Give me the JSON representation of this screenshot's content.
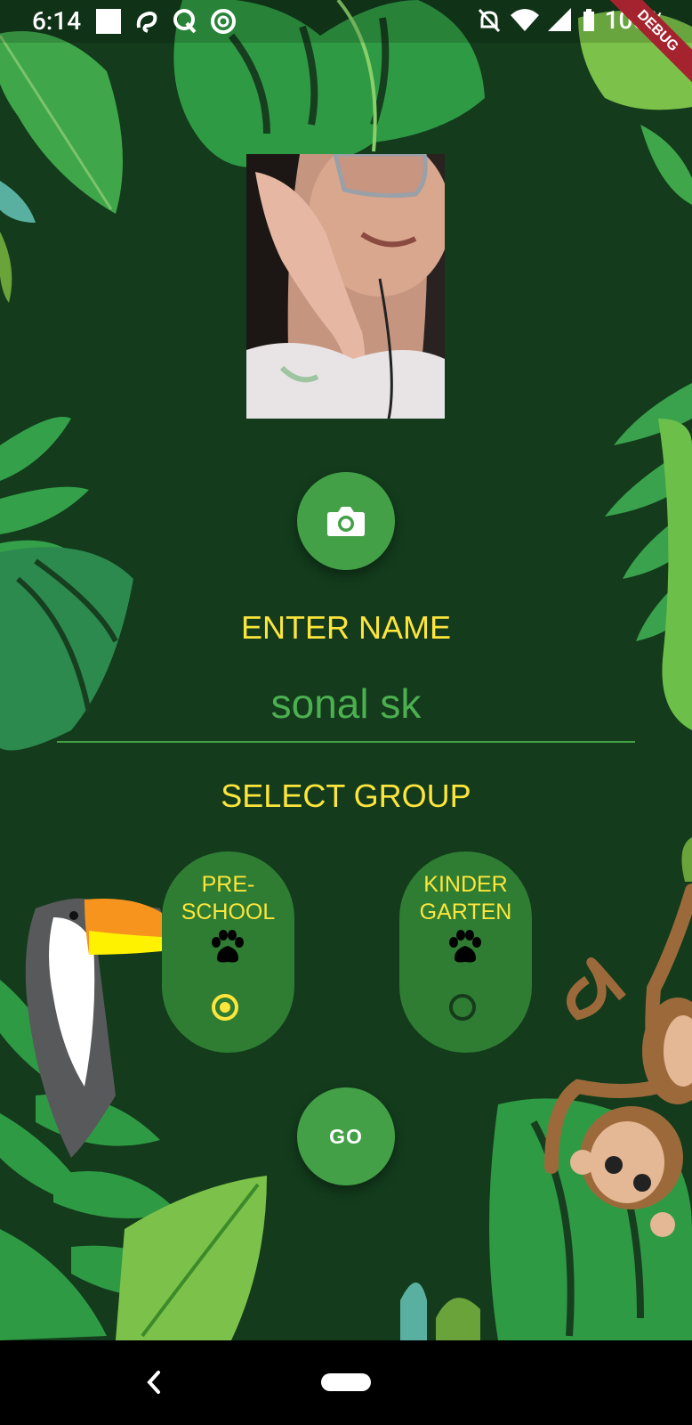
{
  "status_bar": {
    "time": "6:14",
    "battery_percent": "100%",
    "debug_banner": "DEBUG"
  },
  "profile": {
    "photo_alt": "profile-photo"
  },
  "name_section": {
    "heading": "ENTER NAME",
    "input_value": "sonal sk"
  },
  "group_section": {
    "heading": "SELECT GROUP",
    "options": [
      {
        "label": "PRE-\nSCHOOL",
        "selected": true
      },
      {
        "label": "KINDER\nGARTEN",
        "selected": false
      }
    ]
  },
  "go_button": {
    "label": "GO"
  },
  "colors": {
    "background": "#133b1c",
    "accent_green": "#43a047",
    "card_green": "#2e7d32",
    "heading_yellow": "#fde53c",
    "input_text": "#4caf50"
  },
  "icons": [
    "camera-icon",
    "paw-icon",
    "back-icon",
    "home-pill-icon"
  ]
}
